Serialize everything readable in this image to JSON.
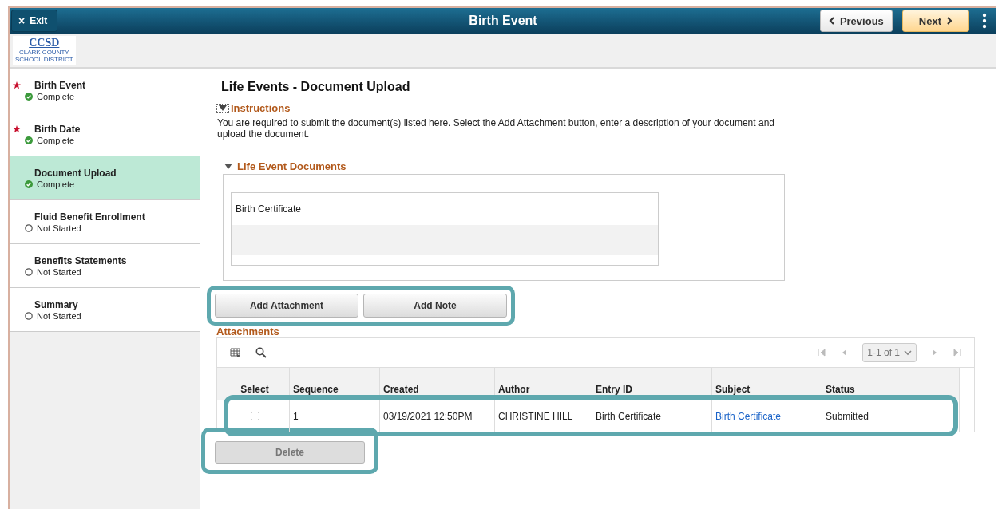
{
  "header": {
    "exit": "Exit",
    "exit_icon": "×",
    "title": "Birth Event",
    "previous": "Previous",
    "next": "Next"
  },
  "logo": {
    "name": "CCSD",
    "subtitle_1": "CLARK COUNTY",
    "subtitle_2": "SCHOOL DISTRICT"
  },
  "sidebar": {
    "items": [
      {
        "label": "Birth Event",
        "status": "Complete",
        "kind": "complete",
        "required": true,
        "selected": false
      },
      {
        "label": "Birth Date",
        "status": "Complete",
        "kind": "complete",
        "required": true,
        "selected": false
      },
      {
        "label": "Document Upload",
        "status": "Complete",
        "kind": "complete",
        "required": false,
        "selected": true
      },
      {
        "label": "Fluid Benefit Enrollment",
        "status": "Not Started",
        "kind": "not_started",
        "required": false,
        "selected": false
      },
      {
        "label": "Benefits Statements",
        "status": "Not Started",
        "kind": "not_started",
        "required": false,
        "selected": false
      },
      {
        "label": "Summary",
        "status": "Not Started",
        "kind": "not_started",
        "required": false,
        "selected": false
      }
    ]
  },
  "page_title": "Life Events - Document Upload",
  "instructions": {
    "title": "Instructions",
    "expanded": true,
    "text": "You are required to submit the document(s) listed here. Select the Add Attachment button, enter a description of your document and upload the document."
  },
  "documents": {
    "title": "Life Event Documents",
    "expanded": true,
    "rows": [
      "Birth Certificate"
    ]
  },
  "buttons": [
    "Add Attachment",
    "Add Note"
  ],
  "attachments": {
    "title": "Attachments",
    "pager": "1-1 of 1",
    "columns": [
      "Select",
      "Sequence",
      "Created",
      "Author",
      "Entry ID",
      "Subject",
      "Status"
    ],
    "rows": [
      {
        "checked": false,
        "sequence": "1",
        "created": "03/19/2021 12:50PM",
        "author": "CHRISTINE HILL",
        "entry_id": "Birth Certificate",
        "subject": "Birth Certificate",
        "status": "Submitted"
      }
    ]
  },
  "delete": {
    "label": "Delete",
    "disabled": true
  }
}
